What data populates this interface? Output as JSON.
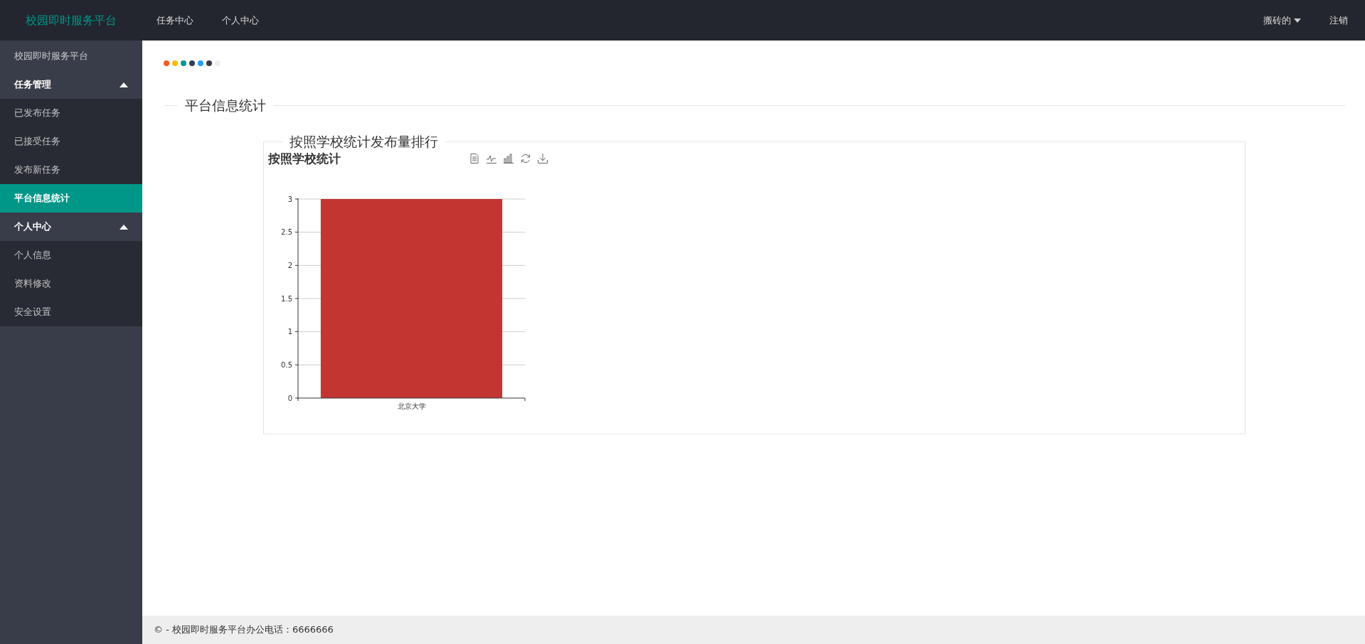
{
  "header": {
    "brand": "校园即时服务平台",
    "nav": [
      {
        "label": "任务中心",
        "selected": false
      },
      {
        "label": "个人中心",
        "selected": false
      }
    ],
    "user_menu": "搬砖的",
    "logout": "注销"
  },
  "sidebar": {
    "title": "校园即时服务平台",
    "groups": [
      {
        "label": "任务管理",
        "expanded": true,
        "children": [
          {
            "label": "已发布任务",
            "selected": false
          },
          {
            "label": "已接受任务",
            "selected": false
          },
          {
            "label": "发布新任务",
            "selected": false
          },
          {
            "label": "平台信息统计",
            "selected": true
          }
        ]
      },
      {
        "label": "个人中心",
        "expanded": true,
        "children": [
          {
            "label": "个人信息",
            "selected": false
          },
          {
            "label": "资料修改",
            "selected": false
          },
          {
            "label": "安全设置",
            "selected": false
          }
        ]
      }
    ]
  },
  "main": {
    "swatches": [
      {
        "color": "#ff5722"
      },
      {
        "color": "#ffb800"
      },
      {
        "color": "#009688"
      },
      {
        "color": "#2f4056"
      },
      {
        "color": "#1e9fff"
      },
      {
        "color": "#393d49"
      },
      {
        "color": "#eeeeee"
      }
    ],
    "section_title": "平台信息统计",
    "panel": {
      "legend": "按照学校统计发布量排行",
      "chart_data": {
        "type": "bar",
        "grid": true,
        "title": "按照学校统计",
        "categories": [
          "北京大学"
        ],
        "values": [
          3
        ],
        "ylim": [
          0,
          3
        ],
        "yticks": [
          0,
          {
            "value": 0.5,
            "label": "0.5"
          },
          1,
          {
            "value": 1.5,
            "label": "1.5"
          },
          2,
          {
            "value": 2.5,
            "label": "2.5"
          },
          3
        ]
      }
    }
  },
  "footer": {
    "text": "© - 校园即时服务平台办公电话：6666666"
  }
}
